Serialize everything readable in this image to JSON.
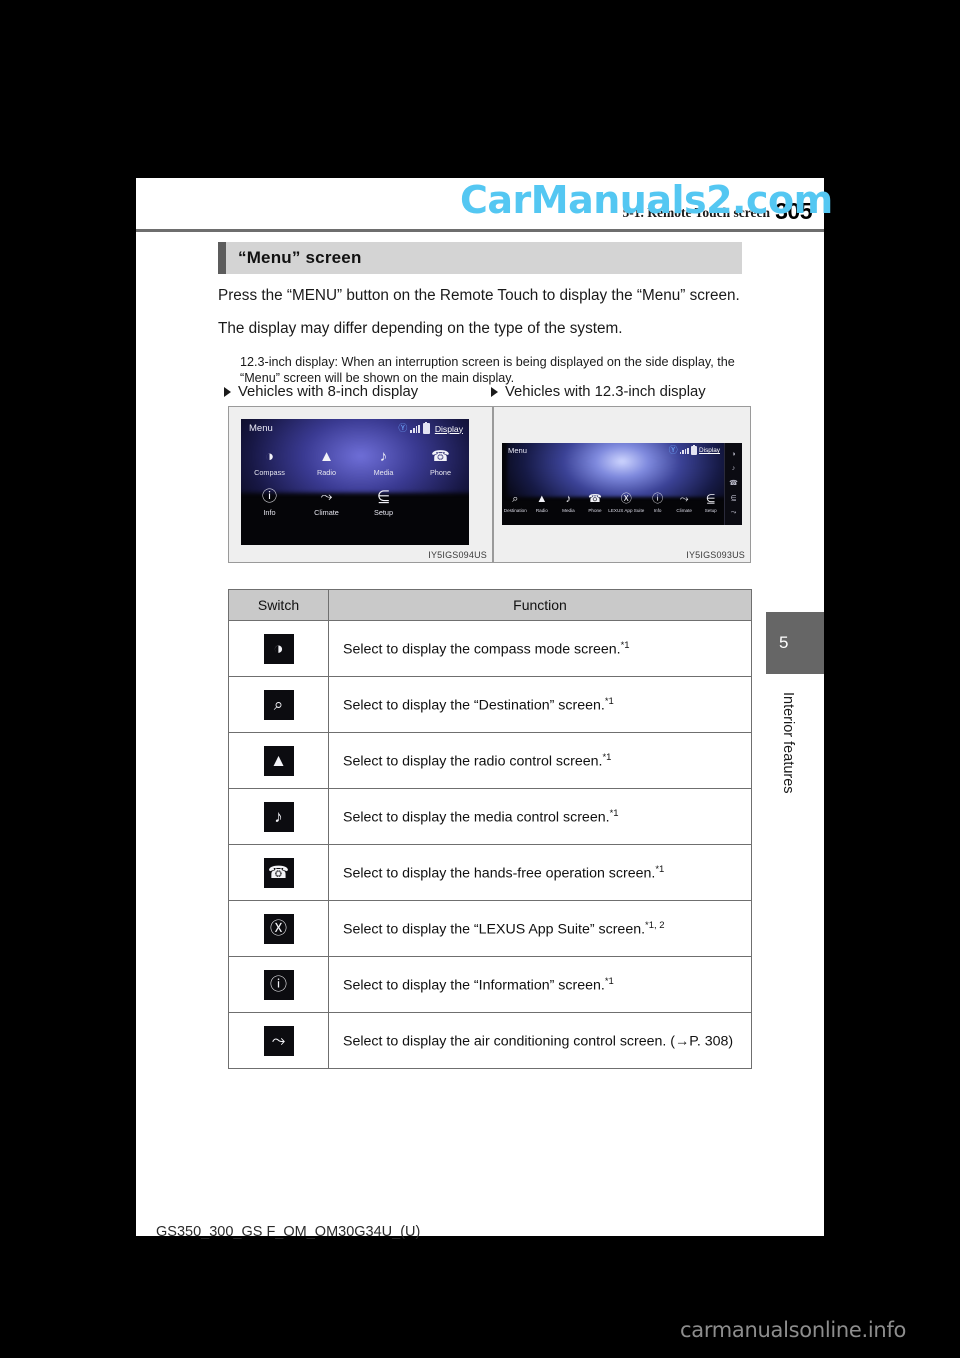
{
  "watermarks": {
    "top": "CarManuals2.com",
    "bottom": "carmanualsonline.info"
  },
  "header": {
    "section_title": "5-1. Remote Touch screen",
    "page_number": "305"
  },
  "section": {
    "heading": "“Menu” screen",
    "paragraph_1": "Press the “MENU” button on the Remote Touch to display the “Menu” screen.",
    "paragraph_2": "The display may differ depending on the type of the system.",
    "note": "12.3-inch display: When an interruption screen is being displayed on the side display, the “Menu” screen will be shown on the main display."
  },
  "figures": [
    {
      "subheading": "Vehicles with 8-inch display",
      "caption": "IY5IGS094US",
      "screen": {
        "title": "Menu",
        "display_button": "Display",
        "items": [
          {
            "label": "Compass",
            "icon": "compass-icon",
            "glyph": "◑"
          },
          {
            "label": "Radio",
            "icon": "radio-tower-icon",
            "glyph": "☲"
          },
          {
            "label": "Media",
            "icon": "music-note-icon",
            "glyph": "♪"
          },
          {
            "label": "Phone",
            "icon": "phone-handset-icon",
            "glyph": "✆"
          },
          {
            "label": "Info",
            "icon": "information-icon",
            "glyph": "ⓘ"
          },
          {
            "label": "Climate",
            "icon": "climate-seat-icon",
            "glyph": "⤳"
          },
          {
            "label": "Setup",
            "icon": "setup-gear-icon",
            "glyph": "⌸"
          }
        ]
      }
    },
    {
      "subheading": "Vehicles with 12.3-inch display",
      "caption": "IY5IGS093US",
      "screen": {
        "title": "Menu",
        "display_button": "Display",
        "items": [
          {
            "label": "Destination",
            "icon": "destination-search-icon",
            "glyph": "⌕"
          },
          {
            "label": "Radio",
            "icon": "radio-tower-icon",
            "glyph": "☲"
          },
          {
            "label": "Media",
            "icon": "music-note-icon",
            "glyph": "♪"
          },
          {
            "label": "Phone",
            "icon": "phone-handset-icon",
            "glyph": "✆"
          },
          {
            "label": "LEXUS App Suite",
            "icon": "lexus-logo-icon",
            "glyph": "Ⓛ"
          },
          {
            "label": "Info",
            "icon": "information-icon",
            "glyph": "ⓘ"
          },
          {
            "label": "Climate",
            "icon": "climate-seat-icon",
            "glyph": "⤳"
          },
          {
            "label": "Setup",
            "icon": "setup-gear-icon",
            "glyph": "⌸"
          }
        ]
      }
    }
  ],
  "table": {
    "headers": {
      "switch": "Switch",
      "function": "Function"
    },
    "rows": [
      {
        "icon": "compass-icon",
        "glyph": "◑",
        "function": "Select to display the compass mode screen.",
        "footnote": "*1"
      },
      {
        "icon": "destination-search-icon",
        "glyph": "⌕",
        "function": "Select to display the “Destination” screen.",
        "footnote": "*1"
      },
      {
        "icon": "radio-tower-icon",
        "glyph": "☲",
        "function": "Select to display the radio control screen.",
        "footnote": "*1"
      },
      {
        "icon": "music-note-icon",
        "glyph": "♪",
        "function": "Select to display the media control screen.",
        "footnote": "*1"
      },
      {
        "icon": "phone-handset-icon",
        "glyph": "✆",
        "function": "Select to display the hands-free operation screen.",
        "footnote": "*1"
      },
      {
        "icon": "lexus-logo-icon",
        "glyph": "Ⓛ",
        "function": "Select to display the “LEXUS App Suite” screen.",
        "footnote": "*1, 2"
      },
      {
        "icon": "information-icon",
        "glyph": "ⓘ",
        "function": "Select to display the “Information” screen.",
        "footnote": "*1"
      },
      {
        "icon": "climate-seat-icon",
        "glyph": "⤳",
        "function": "Select to display the air conditioning control screen. (→P. 308)",
        "footnote": ""
      }
    ]
  },
  "chapter_tab": {
    "number": "5",
    "label": "Interior features"
  },
  "footer": {
    "document_code": "GS350_300_GS F_OM_OM30G34U_(U)"
  }
}
